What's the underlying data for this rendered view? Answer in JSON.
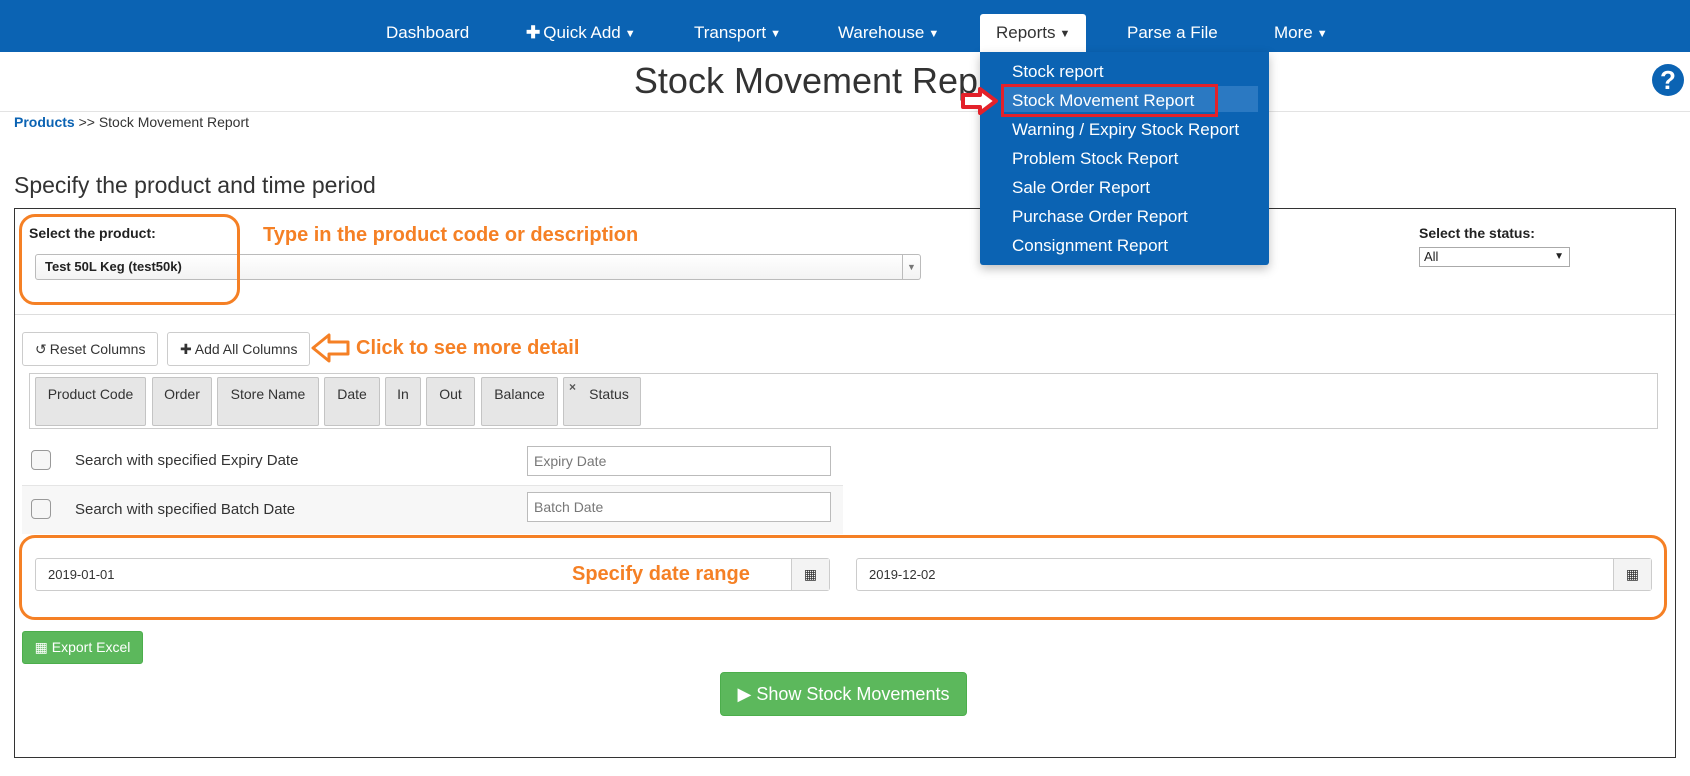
{
  "nav": {
    "dashboard": "Dashboard",
    "quick_add": "Quick Add",
    "transport": "Transport",
    "warehouse": "Warehouse",
    "reports": "Reports",
    "parse_file": "Parse a File",
    "more": "More"
  },
  "reports_menu": {
    "items": [
      "Stock report",
      "Stock Movement Report",
      "Warning / Expiry Stock Report",
      "Problem Stock Report",
      "Sale Order Report",
      "Purchase Order Report",
      "Consignment Report"
    ],
    "highlighted": "Stock Movement Report"
  },
  "page": {
    "title": "Stock Movement Rep",
    "help_icon": "question-circle-icon"
  },
  "breadcrumb": {
    "link": "Products",
    "separator": ">>",
    "current": "Stock Movement Report"
  },
  "section": {
    "title": "Specify the product and time period"
  },
  "product": {
    "label": "Select the product:",
    "value": "Test 50L Keg (test50k)"
  },
  "status": {
    "label": "Select the status:",
    "value": "All"
  },
  "annotations": {
    "product_hint": "Type in the product code or description",
    "columns_hint": "Click to see more detail",
    "date_hint": "Specify date range",
    "color": "#f58025",
    "highlight_color": "#e3212a"
  },
  "toolbar": {
    "reset_columns": "Reset Columns",
    "add_all_columns": "Add All Columns"
  },
  "columns": [
    "Product Code",
    "Order",
    "Store Name",
    "Date",
    "In",
    "Out",
    "Balance",
    "Status"
  ],
  "filters": {
    "expiry_label": "Search with specified Expiry Date",
    "expiry_placeholder": "Expiry Date",
    "batch_label": "Search with specified Batch Date",
    "batch_placeholder": "Batch Date"
  },
  "date_range": {
    "from": "2019-01-01",
    "to": "2019-12-02"
  },
  "actions": {
    "export_excel": "Export Excel",
    "show_movements": "Show Stock Movements"
  },
  "colors": {
    "brand": "#0b63b3",
    "success": "#5cb85c"
  }
}
